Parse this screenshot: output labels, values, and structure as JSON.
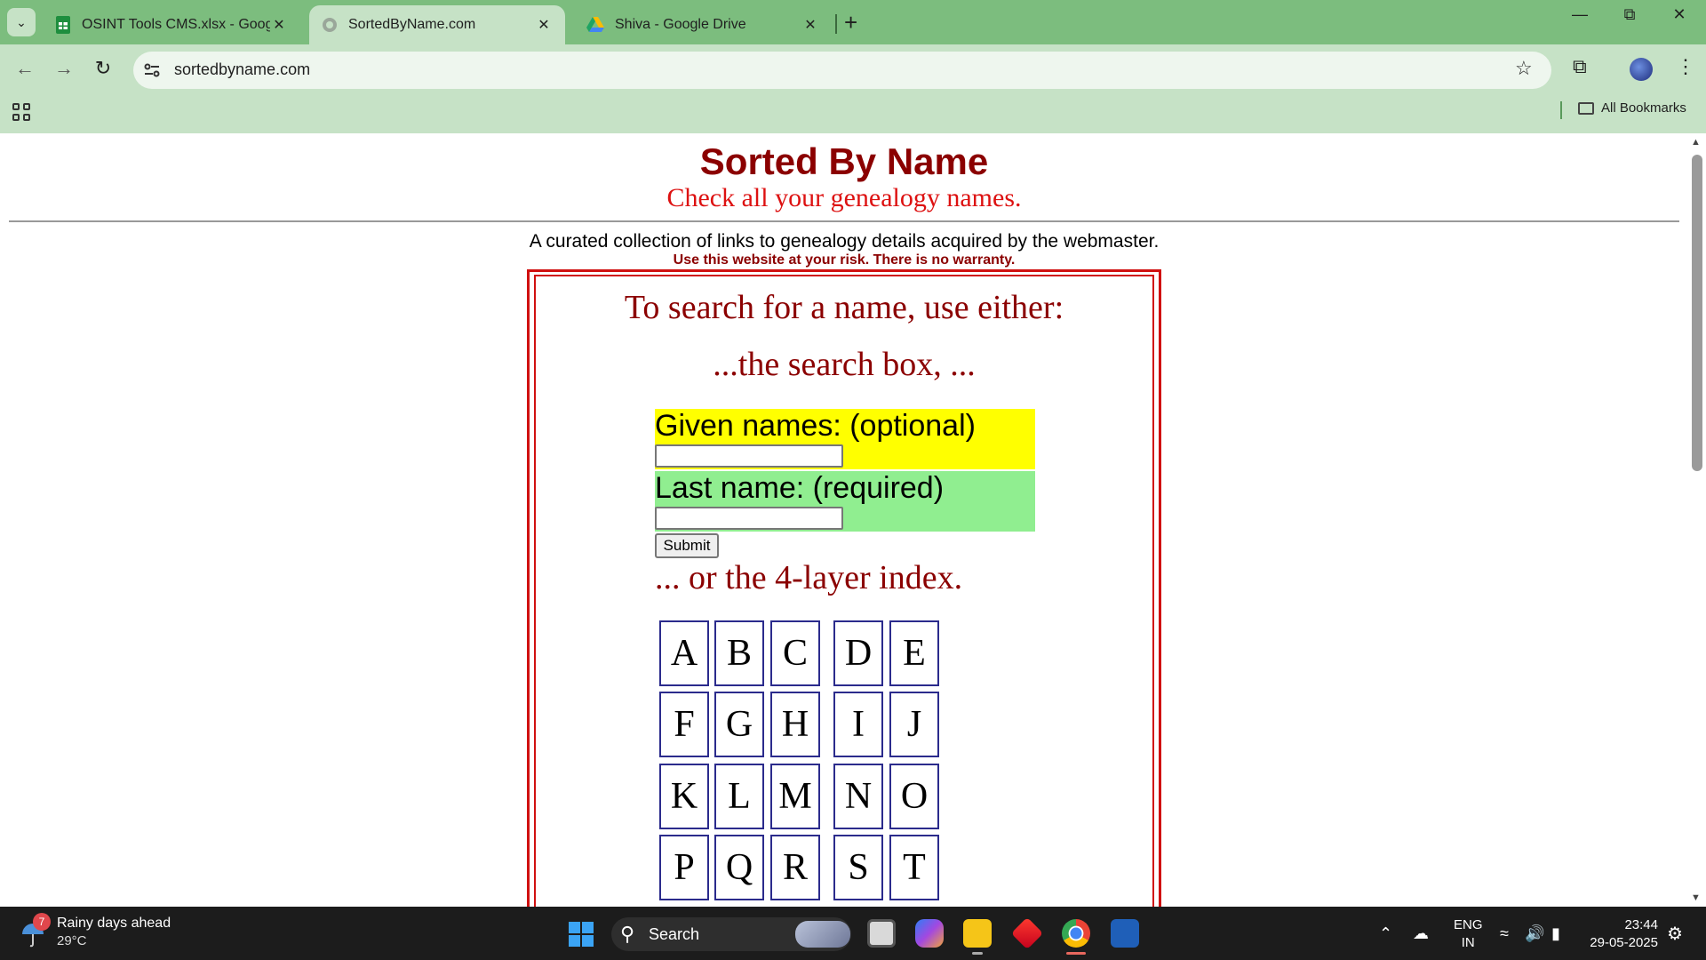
{
  "browser": {
    "tabs": [
      {
        "title": "OSINT Tools CMS.xlsx - Google",
        "icon": "google-sheets-icon",
        "active": false
      },
      {
        "title": "SortedByName.com",
        "icon": "globe-icon",
        "active": true
      },
      {
        "title": "Shiva - Google Drive",
        "icon": "google-drive-icon",
        "active": false
      }
    ],
    "url": "sortedbyname.com",
    "bookmarks_label": "All Bookmarks"
  },
  "page": {
    "title": "Sorted By Name",
    "subtitle": "Check all your genealogy names.",
    "intro": "A curated collection of links to genealogy details acquired by the webmaster.",
    "warning": "Use this website at your risk. There is no warranty.",
    "search_heading": "To search for a name, use either:",
    "search_box_text": "...the search box, ...",
    "form": {
      "given_label": "Given names: (optional)",
      "given_value": "",
      "last_label": "Last name: (required)",
      "last_value": "",
      "submit_label": "Submit"
    },
    "index_text": "... or the 4-layer index.",
    "letters": [
      "A",
      "B",
      "C",
      "D",
      "E",
      "F",
      "G",
      "H",
      "I",
      "J",
      "K",
      "L",
      "M",
      "N",
      "O",
      "P",
      "Q",
      "R",
      "S",
      "T"
    ]
  },
  "taskbar": {
    "weather_badge": "7",
    "weather_title": "Rainy days ahead",
    "weather_temp": "29°C",
    "search_label": "Search",
    "lang_line1": "ENG",
    "lang_line2": "IN",
    "time": "23:44",
    "date": "29-05-2025"
  },
  "colors": {
    "chrome_green": "#7cbd7e",
    "toolbar_green": "#c6e2c6",
    "title_red": "#8b0000",
    "bright_red": "#dd1111",
    "given_bg": "#ffff00",
    "last_bg": "#90ee90",
    "letter_border": "#2b2b8c"
  }
}
